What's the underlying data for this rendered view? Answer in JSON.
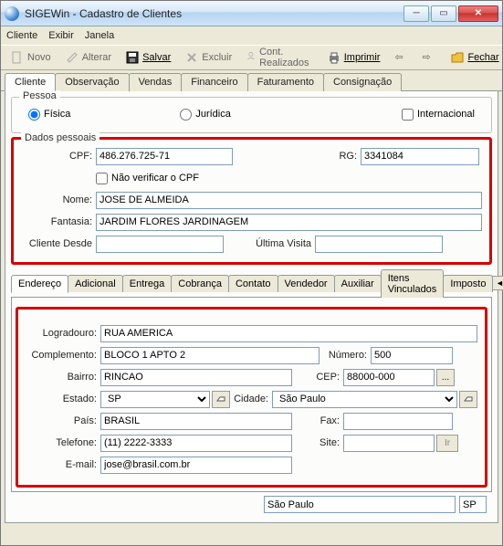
{
  "window": {
    "title": "SIGEWin - Cadastro de Clientes"
  },
  "menu": {
    "cliente": "Cliente",
    "exibir": "Exibir",
    "janela": "Janela"
  },
  "toolbar": {
    "novo": "Novo",
    "alterar": "Alterar",
    "salvar": "Salvar",
    "excluir": "Excluir",
    "cont": "Cont. Realizados",
    "imprimir": "Imprimir",
    "fechar": "Fechar"
  },
  "tabs": {
    "cliente": "Cliente",
    "observacao": "Observação",
    "vendas": "Vendas",
    "financeiro": "Financeiro",
    "faturamento": "Faturamento",
    "consignacao": "Consignação"
  },
  "pessoa": {
    "legend": "Pessoa",
    "fisica": "Física",
    "juridica": "Jurídica",
    "internacional": "Internacional"
  },
  "dados": {
    "legend": "Dados pessoais",
    "cpf_label": "CPF:",
    "cpf": "486.276.725-71",
    "rg_label": "RG:",
    "rg": "3341084",
    "naoverificar": "Não verificar o CPF",
    "nome_label": "Nome:",
    "nome": "JOSE DE ALMEIDA",
    "fantasia_label": "Fantasia:",
    "fantasia": "JARDIM FLORES JARDINAGEM",
    "desde_label": "Cliente Desde",
    "desde": "",
    "visita_label": "Última Visita",
    "visita": ""
  },
  "subtabs": {
    "endereco": "Endereço",
    "adicional": "Adicional",
    "entrega": "Entrega",
    "cobranca": "Cobrança",
    "contato": "Contato",
    "vendedor": "Vendedor",
    "auxiliar": "Auxiliar",
    "itens": "Itens Vinculados",
    "impostos": "Imposto"
  },
  "endereco": {
    "logradouro_label": "Logradouro:",
    "logradouro": "RUA AMERICA",
    "complemento_label": "Complemento:",
    "complemento": "BLOCO 1 APTO 2",
    "numero_label": "Número:",
    "numero": "500",
    "bairro_label": "Bairro:",
    "bairro": "RINCAO",
    "cep_label": "CEP:",
    "cep": "88000-000",
    "estado_label": "Estado:",
    "estado": "SP",
    "cidade_label": "Cidade:",
    "cidade": "São Paulo",
    "pais_label": "País:",
    "pais": "BRASIL",
    "fax_label": "Fax:",
    "fax": "",
    "telefone_label": "Telefone:",
    "telefone": "(11) 2222-3333",
    "site_label": "Site:",
    "site": "",
    "ir": "Ir",
    "email_label": "E-mail:",
    "email": "jose@brasil.com.br",
    "cep_btn": "..."
  },
  "status": {
    "cidade": "São Paulo",
    "uf": "SP"
  }
}
